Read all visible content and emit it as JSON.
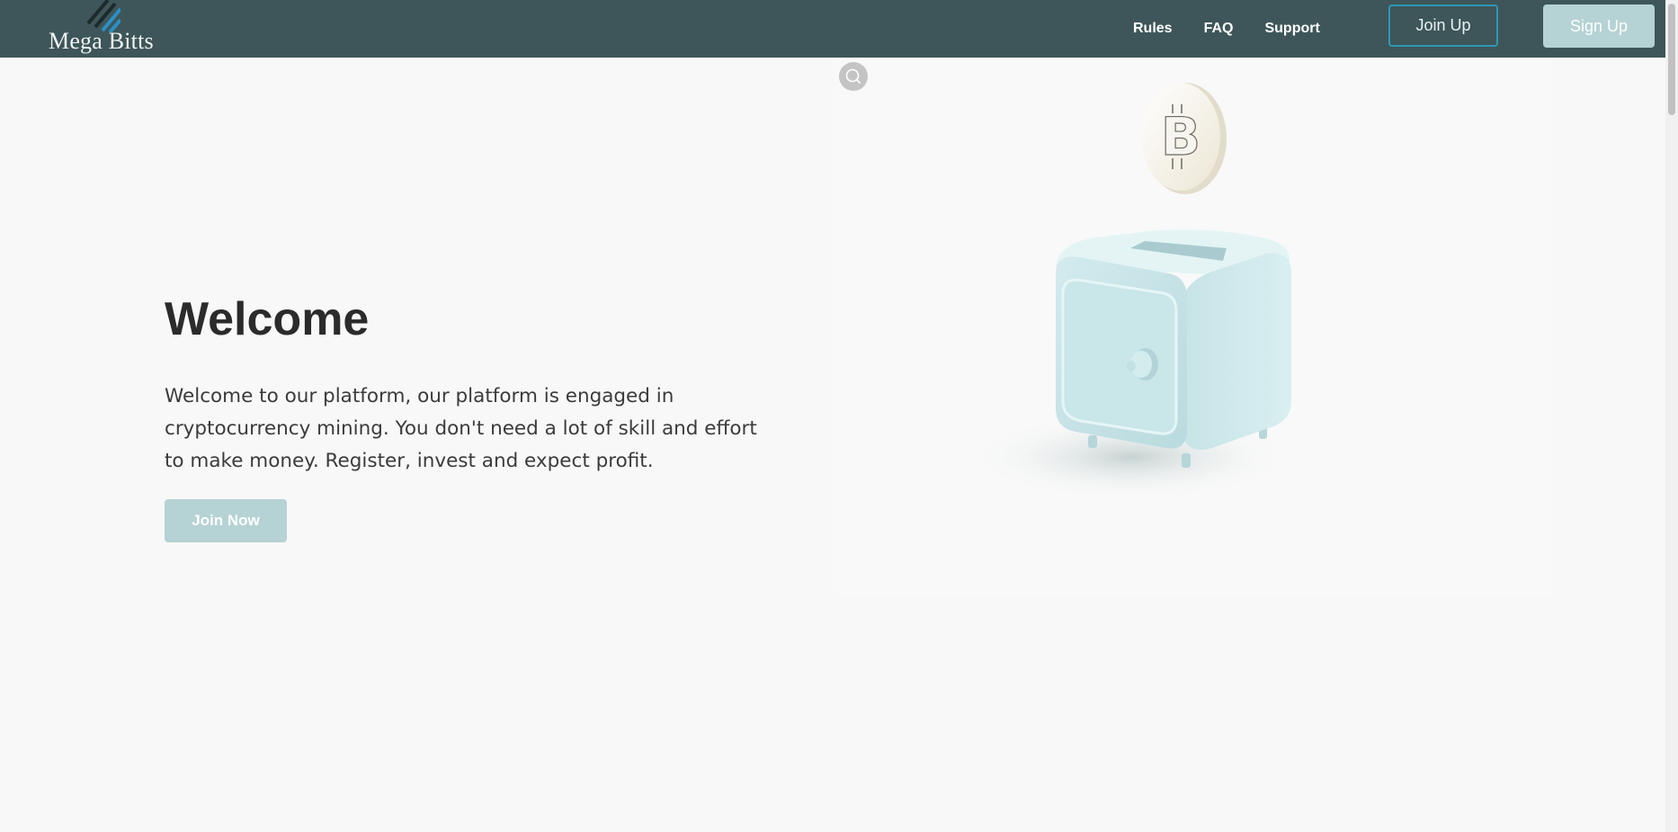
{
  "header": {
    "brand": "Mega Bitts",
    "nav": [
      {
        "label": "Rules"
      },
      {
        "label": "FAQ"
      },
      {
        "label": "Support"
      }
    ],
    "join_up_label": "Join Up",
    "sign_up_label": "Sign Up"
  },
  "hero": {
    "title": "Welcome",
    "description": "Welcome to our platform, our platform is engaged in cryptocurrency mining. You don't need a lot of skill and effort to make money. Register, invest and expect profit.",
    "cta_label": "Join Now"
  },
  "illustration": {
    "icons": [
      "zoom-icon",
      "bitcoin-coin-icon",
      "safe-box-icon"
    ]
  },
  "colors": {
    "header_bg": "#3e5659",
    "accent": "#b5d2d4",
    "outline_border": "#2e98b6",
    "page_bg": "#f8f8f8"
  }
}
